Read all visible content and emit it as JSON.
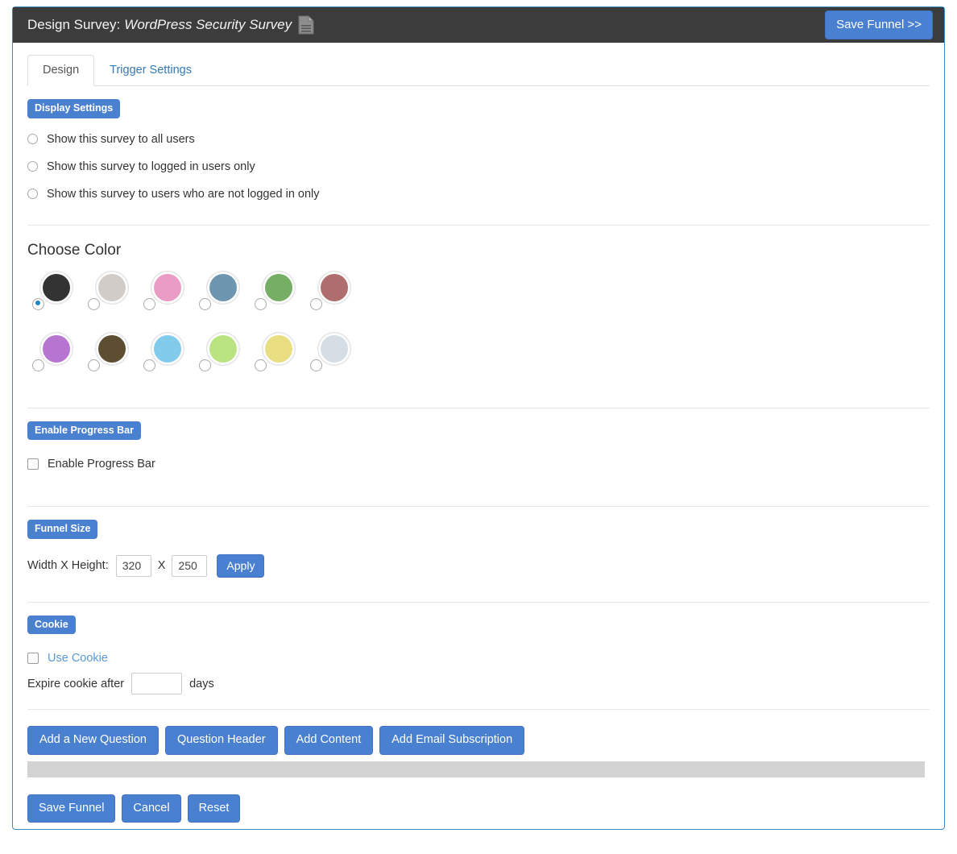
{
  "header": {
    "title_label": "Design Survey:",
    "survey_name": "WordPress Security Survey",
    "doc_icon": "document-icon",
    "save_funnel_label": "Save Funnel >>"
  },
  "tabs": [
    {
      "label": "Design",
      "active": true
    },
    {
      "label": "Trigger Settings",
      "active": false
    }
  ],
  "display_settings": {
    "badge": "Display Settings",
    "options": [
      {
        "label": "Show this survey to all users",
        "checked": false
      },
      {
        "label": "Show this survey to logged in users only",
        "checked": false
      },
      {
        "label": "Show this survey to users who are not logged in only",
        "checked": false
      }
    ]
  },
  "choose_color": {
    "title": "Choose Color",
    "selected_index": 0,
    "swatches": [
      {
        "name": "charcoal",
        "hex": "#333333"
      },
      {
        "name": "light-gray",
        "hex": "#d2ccc8"
      },
      {
        "name": "pink",
        "hex": "#eb9cc4"
      },
      {
        "name": "steel-blue",
        "hex": "#6e96b0"
      },
      {
        "name": "green",
        "hex": "#75ae64"
      },
      {
        "name": "muted-red",
        "hex": "#b06d6d"
      },
      {
        "name": "purple",
        "hex": "#b775d2"
      },
      {
        "name": "dark-brown",
        "hex": "#5d4d31"
      },
      {
        "name": "sky-blue",
        "hex": "#82cbeb"
      },
      {
        "name": "lime-green",
        "hex": "#bae382"
      },
      {
        "name": "yellow",
        "hex": "#e9de82"
      },
      {
        "name": "pale-blue-gray",
        "hex": "#d4dee4"
      }
    ]
  },
  "progress_bar": {
    "badge": "Enable Progress Bar",
    "checkbox_label": "Enable Progress Bar",
    "checked": false
  },
  "funnel_size": {
    "badge": "Funnel Size",
    "label": "Width X Height:",
    "width_value": "320",
    "separator": "X",
    "height_value": "250",
    "apply_label": "Apply"
  },
  "cookie": {
    "badge": "Cookie",
    "use_cookie_label": "Use Cookie",
    "use_cookie_checked": false,
    "expire_prefix": "Expire cookie after",
    "expire_value": "",
    "expire_suffix": "days"
  },
  "actions": {
    "add_question": "Add a New Question",
    "question_header": "Question Header",
    "add_content": "Add Content",
    "add_email_subscription": "Add Email Subscription"
  },
  "footer": {
    "save_funnel": "Save Funnel",
    "cancel": "Cancel",
    "reset": "Reset"
  },
  "colors": {
    "accent_blue": "#4a80d0",
    "header_bar": "#3c3c3c",
    "border_blue": "#3c8dbc",
    "link_blue": "#337ab7",
    "gray_bar": "#d3d3d3"
  }
}
